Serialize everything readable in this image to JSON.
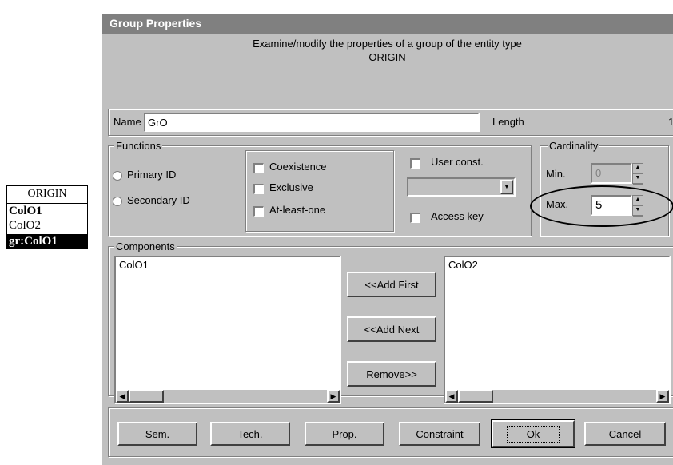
{
  "entity": {
    "header": "ORIGIN",
    "rows": [
      "ColO1",
      "ColO2"
    ],
    "selected": "gr:ColO1"
  },
  "dialog": {
    "title": "Group Properties",
    "description_line1": "Examine/modify the properties of a group of the entity type",
    "description_line2": "ORIGIN",
    "name_label": "Name",
    "name_value": "GrO",
    "length_label": "Length",
    "length_value": "1",
    "functions": {
      "legend": "Functions",
      "primary_id": "Primary ID",
      "secondary_id": "Secondary ID",
      "coexistence": "Coexistence",
      "exclusive": "Exclusive",
      "at_least_one": "At-least-one",
      "user_const": "User const.",
      "access_key": "Access key"
    },
    "cardinality": {
      "legend": "Cardinality",
      "min_label": "Min.",
      "min_value": "0",
      "max_label": "Max.",
      "max_value": "5"
    },
    "components": {
      "legend": "Components",
      "left_items": [
        "ColO1"
      ],
      "right_items": [
        "ColO2"
      ],
      "add_first": "<<Add First",
      "add_next": "<<Add Next",
      "remove": "Remove>>"
    },
    "buttons": {
      "sem": "Sem.",
      "tech": "Tech.",
      "prop": "Prop.",
      "constraint": "Constraint",
      "ok": "Ok",
      "cancel": "Cancel"
    }
  }
}
